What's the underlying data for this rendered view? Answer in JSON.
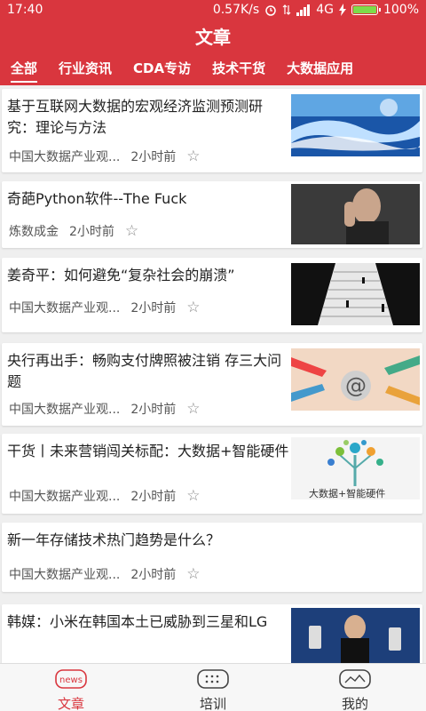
{
  "status": {
    "time": "17:40",
    "speed": "0.57K/s",
    "network": "4G",
    "battery": "100%",
    "battery_level": 1.0
  },
  "header": {
    "title": "文章"
  },
  "tabs": [
    {
      "label": "全部"
    },
    {
      "label": "行业资讯"
    },
    {
      "label": "CDA专访"
    },
    {
      "label": "技术干货"
    },
    {
      "label": "大数据应用"
    }
  ],
  "articles": [
    {
      "title": "基于互联网大数据的宏观经济监测预测研究：理论与方法",
      "source": "中国大数据产业观...",
      "time": "2小时前",
      "thumb": "data-ribbons"
    },
    {
      "title": "奇葩Python软件--The Fuck",
      "source": "炼数成金",
      "time": "2小时前",
      "thumb": "man-gesture"
    },
    {
      "title": "姜奇平：如何避免“复杂社会的崩溃”",
      "source": "中国大数据产业观...",
      "time": "2小时前",
      "thumb": "stairs-figures"
    },
    {
      "title": "央行再出手：畅购支付牌照被注销 存三大问题",
      "source": "中国大数据产业观...",
      "time": "2小时前",
      "thumb": "at-sign-hands"
    },
    {
      "title": "干货丨未来营销闯关标配：大数据+智能硬件",
      "source": "中国大数据产业观...",
      "time": "2小时前",
      "thumb": "tree-icons",
      "thumb_caption": "大数据+智能硬件"
    },
    {
      "title": "新一年存储技术热门趋势是什么？",
      "source": "中国大数据产业观...",
      "time": "2小时前"
    },
    {
      "title": "韩媒：小米在韩国本土已威胁到三星和LG",
      "source": "",
      "time": "",
      "thumb": "presenter-phones"
    }
  ],
  "bottom_nav": [
    {
      "label": "文章",
      "icon": "news-icon",
      "badge": "news"
    },
    {
      "label": "培训",
      "icon": "calendar-icon"
    },
    {
      "label": "我的",
      "icon": "profile-icon"
    }
  ],
  "colors": {
    "brand": "#d9363e",
    "background": "#efefef"
  }
}
